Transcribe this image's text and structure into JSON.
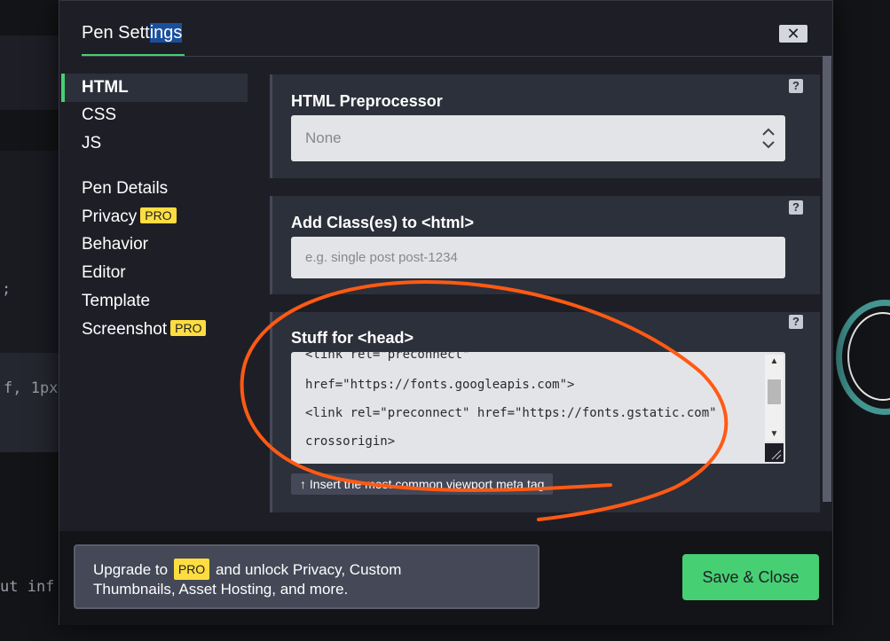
{
  "modal": {
    "title_start": "Pen Sett",
    "title_selected": "ings",
    "close_glyph": "✕"
  },
  "sidebar": {
    "items": [
      {
        "label": "HTML",
        "active": true
      },
      {
        "label": "CSS"
      },
      {
        "label": "JS"
      },
      {
        "label": "Pen Details"
      },
      {
        "label": "Privacy",
        "badge": "PRO"
      },
      {
        "label": "Behavior"
      },
      {
        "label": "Editor"
      },
      {
        "label": "Template"
      },
      {
        "label": "Screenshot",
        "badge": "PRO"
      }
    ]
  },
  "panels": {
    "preprocessor": {
      "label": "HTML Preprocessor",
      "value": "None",
      "help": "?"
    },
    "classes": {
      "label": "Add Class(es) to <html>",
      "placeholder": "e.g. single post post-1234",
      "help": "?"
    },
    "head": {
      "label": "Stuff for <head>",
      "help": "?",
      "lines": [
        "<link rel=\"preconnect\"",
        "href=\"https://fonts.googleapis.com\">",
        "<link rel=\"preconnect\" href=\"https://fonts.gstatic.com\"",
        "crossorigin>"
      ],
      "viewport_button": "↑ Insert the most common viewport meta tag"
    }
  },
  "footer": {
    "upgrade_prefix": "Upgrade to",
    "upgrade_badge": "PRO",
    "upgrade_suffix": "and unlock Privacy, Custom",
    "upgrade_line2": "Thumbnails, Asset Hosting, and more.",
    "save_label": "Save & Close"
  },
  "background": {
    "code_fragments": [
      ";",
      "f, 1px",
      "ut inf"
    ]
  },
  "colors": {
    "accent_green": "#47cf73",
    "pro_yellow": "#ffdd40",
    "annotation_orange": "#ff5a14"
  }
}
